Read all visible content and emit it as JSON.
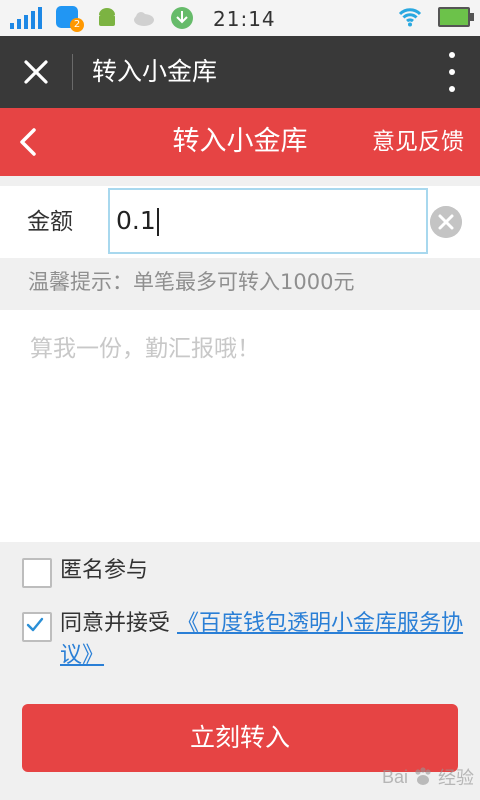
{
  "status_bar": {
    "time": "21:14",
    "notification_badge": "2"
  },
  "app_bar": {
    "title": "转入小金库"
  },
  "header": {
    "title": "转入小金库",
    "feedback_label": "意见反馈"
  },
  "form": {
    "amount_label": "金额",
    "amount_value": "0.1"
  },
  "hint": "温馨提示：单笔最多可转入1000元",
  "message": {
    "placeholder": "算我一份，勤汇报哦！"
  },
  "options": {
    "anonymous_label": "匿名参与",
    "agree_prefix": "同意并接受",
    "agreement_link": "《百度钱包透明小金库服务协议》"
  },
  "submit_label": "立刻转入",
  "watermark": {
    "brand": "Bai",
    "suffix": "经验"
  },
  "colors": {
    "brand_red": "#e64444",
    "dark_bar": "#393939",
    "link_blue": "#2a7fd6"
  }
}
